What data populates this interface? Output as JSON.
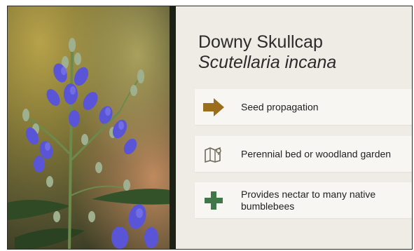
{
  "slide": {
    "common_name": "Downy Skullcap",
    "scientific_name": "Scutellaria incana",
    "photo_icon": "skullcap-flower-photo"
  },
  "items": [
    {
      "text": "Seed propagation",
      "icon": "arrow-right-icon",
      "color": "#9b6d1d"
    },
    {
      "text": "Perennial bed or woodland garden",
      "icon": "garden-map-icon",
      "color": "#6f6a5a"
    },
    {
      "text": "Provides nectar to many native bumblebees",
      "icon": "plus-icon",
      "color": "#3f7748"
    }
  ],
  "colors": {
    "panel_bg": "#efece6",
    "card_bg": "#f7f6f3",
    "divider": "#1d2014",
    "flower": "#5a55d6"
  }
}
